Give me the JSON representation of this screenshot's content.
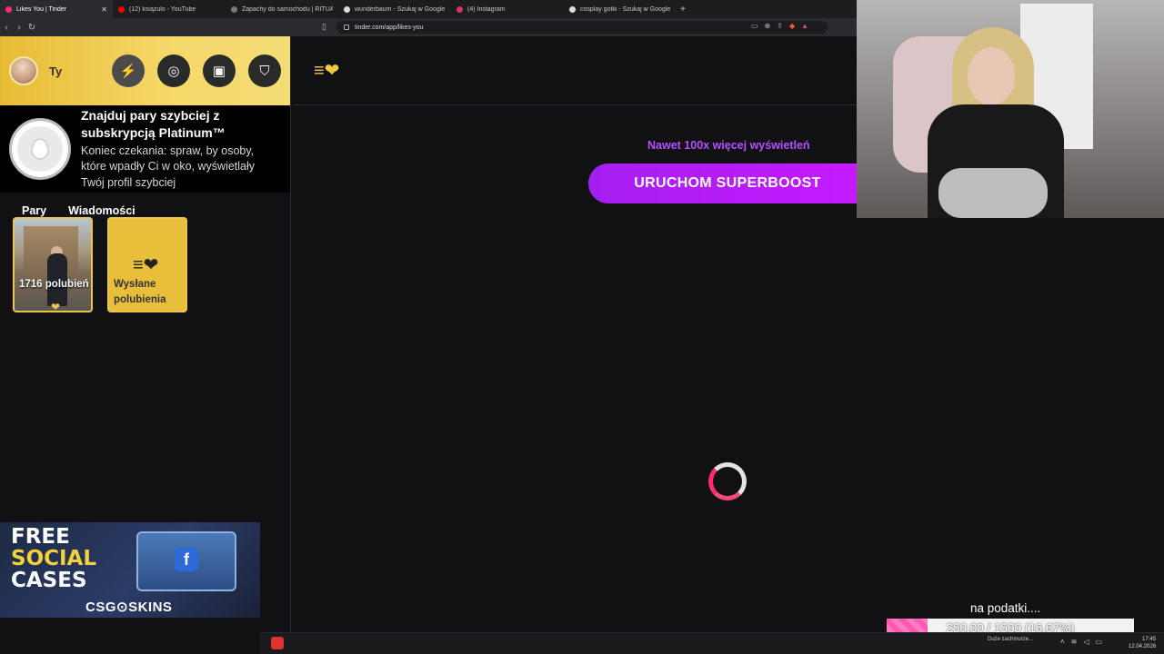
{
  "browser": {
    "tabs": [
      {
        "label": "Likes You | Tinder",
        "active": true,
        "favicon_color": "#fd2b6c"
      },
      {
        "label": "(12) książulo - YouTube",
        "active": false,
        "favicon_color": "#ff0000"
      },
      {
        "label": "Zapachy do samochodu | RITUALS",
        "active": false,
        "favicon_color": "#777777"
      },
      {
        "label": "wunderbaum - Szukaj w Google",
        "active": false,
        "favicon_color": "#dddddd"
      },
      {
        "label": "(4) Instagram",
        "active": false,
        "favicon_color": "#e1306c"
      },
      {
        "label": "cosplay gotki - Szukaj w Google",
        "active": false,
        "favicon_color": "#dddddd"
      }
    ],
    "url": "tinder.com/app/likes-you"
  },
  "sidebar": {
    "user_name": "Ty",
    "header_buttons": [
      "boost-icon",
      "explore-icon",
      "briefcase-icon",
      "shield-icon"
    ],
    "promo": {
      "title": "Znajduj pary szybciej z subskrypcją Platinum™",
      "subtitle": "Koniec czekania: spraw, by osoby, które wpadły Ci w oko, wyświetlały Twój profil szybciej"
    },
    "tabs": [
      {
        "label": "Pary",
        "active": true
      },
      {
        "label": "Wiadomości",
        "active": false
      }
    ],
    "cards": {
      "likes_count": "1716 polubień",
      "sent_likes": "Wysłane polubienia"
    }
  },
  "main": {
    "boost_note": "Nawet 100x więcej wyświetleń",
    "boost_button": "URUCHOM SUPERBOOST"
  },
  "ad": {
    "line1": "FREE",
    "line2": "SOCIAL",
    "line3": "CASES",
    "brand": "CSG⊙SKINS"
  },
  "donation_goal": {
    "label": "na podatki....",
    "text": "250.00 / 1500 (16.67%)",
    "progress": 0.1667
  },
  "taskbar": {
    "weather": "Duże zachmurze...",
    "time": "17:45",
    "date": "12.04.2026"
  },
  "colors": {
    "accent": "#fd2b6c",
    "gold": "#e9c64d",
    "boost_purple": "#b84dff"
  }
}
